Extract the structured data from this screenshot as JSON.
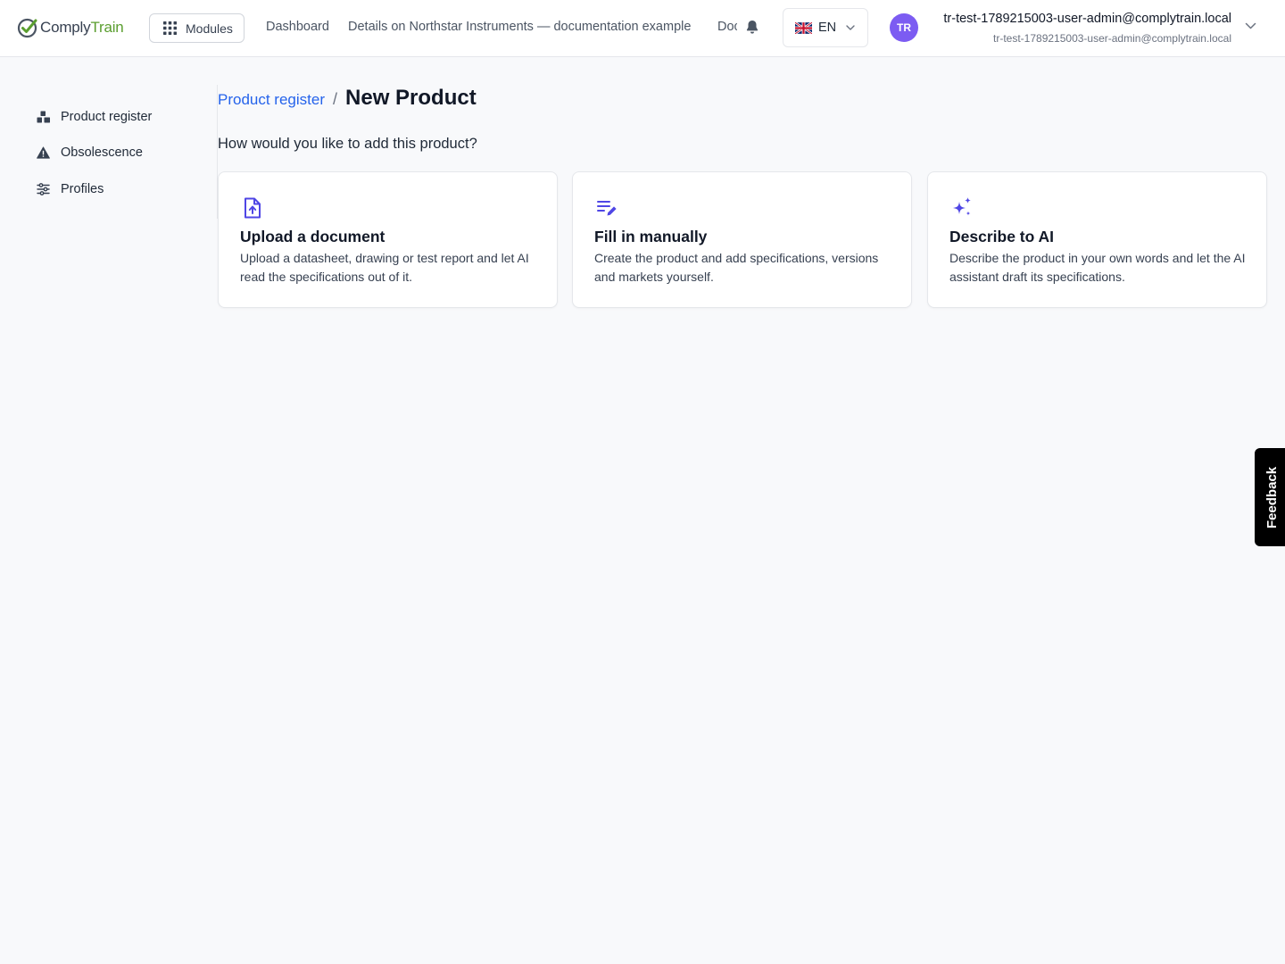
{
  "brand": {
    "name_part1": "Comply",
    "name_part2": "Train",
    "accent": "#5a9e2f"
  },
  "header": {
    "modules_label": "Modules",
    "nav": [
      {
        "label": "Dashboard"
      },
      {
        "label": "Details on Northstar Instruments — documentation example"
      },
      {
        "label": "Doc"
      }
    ],
    "language": {
      "code": "EN",
      "flag": "uk-flag-icon"
    },
    "user": {
      "initials": "TR",
      "name": "tr-test-1789215003-user-admin@complytrain.local",
      "email": "tr-test-1789215003-user-admin@complytrain.local",
      "avatar_color": "#7c5cf2"
    }
  },
  "sidebar": {
    "items": [
      {
        "label": "Product register",
        "icon": "boxes-icon"
      },
      {
        "label": "Obsolescence",
        "icon": "warning-triangle-icon"
      },
      {
        "label": "Profiles",
        "icon": "sliders-icon"
      }
    ]
  },
  "main": {
    "breadcrumb": {
      "parent": "Product register",
      "separator": "/",
      "current": "New Product"
    },
    "question": "How would you like to add this product?",
    "options": [
      {
        "title": "Upload a document",
        "description": "Upload a datasheet, drawing or test report and let AI read the specifications out of it.",
        "icon": "file-upload-icon"
      },
      {
        "title": "Fill in manually",
        "description": "Create the product and add specifications, versions and markets yourself.",
        "icon": "edit-list-icon"
      },
      {
        "title": "Describe to AI",
        "description": "Describe the product in your own words and let the AI assistant draft its specifications.",
        "icon": "sparkles-icon"
      }
    ],
    "icon_color": "#4f46e5"
  },
  "feedback_label": "Feedback"
}
